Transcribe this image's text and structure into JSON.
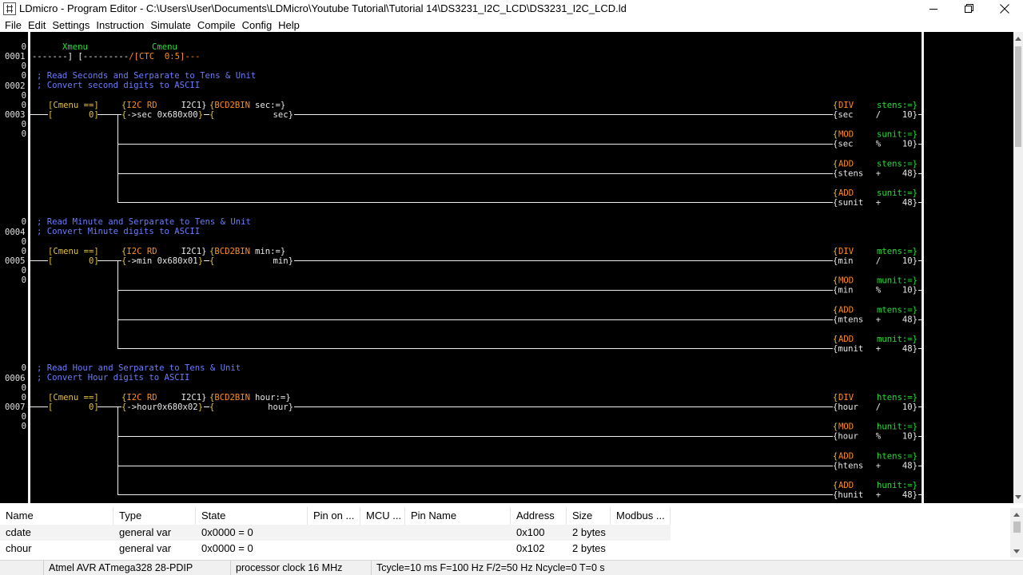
{
  "window": {
    "title": "LDmicro - Program Editor - C:\\Users\\User\\Documents\\LDMicro\\Youtube Tutorial\\Tutorial 14\\DS3231_I2C_LCD\\DS3231_I2C_LCD.ld"
  },
  "menu": [
    "File",
    "Edit",
    "Settings",
    "Instruction",
    "Simulate",
    "Compile",
    "Config",
    "Help"
  ],
  "ladder": {
    "rung_numbers": [
      "0001",
      "0002",
      "0003",
      "0004",
      "0005",
      "0006",
      "0007"
    ],
    "rung1": {
      "label_xmenu": "Xmenu",
      "label_cmenu": "Cmenu",
      "wire_a": "-------] [---------",
      "ctc_open": "/[",
      "ctc_text": "CTC  0:5",
      "ctc_close": "]---"
    },
    "comments": {
      "c2a": "; Read Seconds and Serparate to Tens & Unit",
      "c2b": "; Convert second digits to ASCII",
      "c4a": "; Read Minute and Serparate to Tens & Unit",
      "c4b": "; Convert Minute digits to ASCII",
      "c6a": "; Read Hour and Serparate to Tens & Unit",
      "c6b": "; Convert Hour digits to ASCII"
    },
    "sec": {
      "cmp_top": "[Cmenu ==]",
      "cmp_bot": "[       0]",
      "i2c_name": "I2C RD",
      "i2c_dev": "I2C1}",
      "i2c_param": "->sec 0x680x00",
      "bcd_name": "BCD2BIN",
      "bcd_dest": "sec:=}",
      "bcd_src": "sec}",
      "ops": [
        {
          "op": "DIV",
          "dest": "stens:=}",
          "src": "{sec",
          "sym": "/",
          "val": "10}"
        },
        {
          "op": "MOD",
          "dest": "sunit:=}",
          "src": "{sec",
          "sym": "%",
          "val": "10}"
        },
        {
          "op": "ADD",
          "dest": "stens:=}",
          "src": "{stens",
          "sym": "+",
          "val": "48}"
        },
        {
          "op": "ADD",
          "dest": "sunit:=}",
          "src": "{sunit",
          "sym": "+",
          "val": "48}"
        }
      ]
    },
    "min": {
      "cmp_top": "[Cmenu ==]",
      "cmp_bot": "[       0]",
      "i2c_name": "I2C RD",
      "i2c_dev": "I2C1}",
      "i2c_param": "->min 0x680x01",
      "bcd_name": "BCD2BIN",
      "bcd_dest": "min:=}",
      "bcd_src": "min}",
      "ops": [
        {
          "op": "DIV",
          "dest": "mtens:=}",
          "src": "{min",
          "sym": "/",
          "val": "10}"
        },
        {
          "op": "MOD",
          "dest": "munit:=}",
          "src": "{min",
          "sym": "%",
          "val": "10}"
        },
        {
          "op": "ADD",
          "dest": "mtens:=}",
          "src": "{mtens",
          "sym": "+",
          "val": "48}"
        },
        {
          "op": "ADD",
          "dest": "munit:=}",
          "src": "{munit",
          "sym": "+",
          "val": "48}"
        }
      ]
    },
    "hour": {
      "cmp_top": "[Cmenu ==]",
      "cmp_bot": "[       0]",
      "i2c_name": "I2C RD",
      "i2c_dev": "I2C1}",
      "i2c_param": "->hour0x680x02",
      "bcd_name": "BCD2BIN",
      "bcd_dest": "hour:=}",
      "bcd_src": "hour}",
      "ops": [
        {
          "op": "DIV",
          "dest": "htens:=}",
          "src": "{hour",
          "sym": "/",
          "val": "10}"
        },
        {
          "op": "MOD",
          "dest": "hunit:=}",
          "src": "{hour",
          "sym": "%",
          "val": "10}"
        },
        {
          "op": "ADD",
          "dest": "htens:=}",
          "src": "{htens",
          "sym": "+",
          "val": "48}"
        },
        {
          "op": "ADD",
          "dest": "hunit:=}",
          "src": "{hunit",
          "sym": "+",
          "val": "48}"
        }
      ]
    }
  },
  "varlist": {
    "columns": [
      "Name",
      "Type",
      "State",
      "Pin on ...",
      "MCU ...",
      "Pin Name",
      "Address",
      "Size",
      "Modbus ..."
    ],
    "rows": [
      {
        "name": "cdate",
        "type": "general var",
        "state": "0x0000 = 0",
        "pin": "",
        "mcu": "",
        "pin_name": "",
        "address": "0x100",
        "size": "2 bytes",
        "modbus": ""
      },
      {
        "name": "chour",
        "type": "general var",
        "state": "0x0000 = 0",
        "pin": "",
        "mcu": "",
        "pin_name": "",
        "address": "0x102",
        "size": "2 bytes",
        "modbus": ""
      }
    ]
  },
  "status": {
    "mcu": "Atmel AVR ATmega328 28-PDIP",
    "clock": "processor clock 16 MHz",
    "cycle": "Tcycle=10 ms F=100 Hz F/2=50 Hz Ncycle=0 T=0 s"
  },
  "colors": {
    "background": "#000000",
    "comment": "#6c7bff",
    "instruction": "#ff8c1a",
    "rail": "#f0f0f0"
  }
}
